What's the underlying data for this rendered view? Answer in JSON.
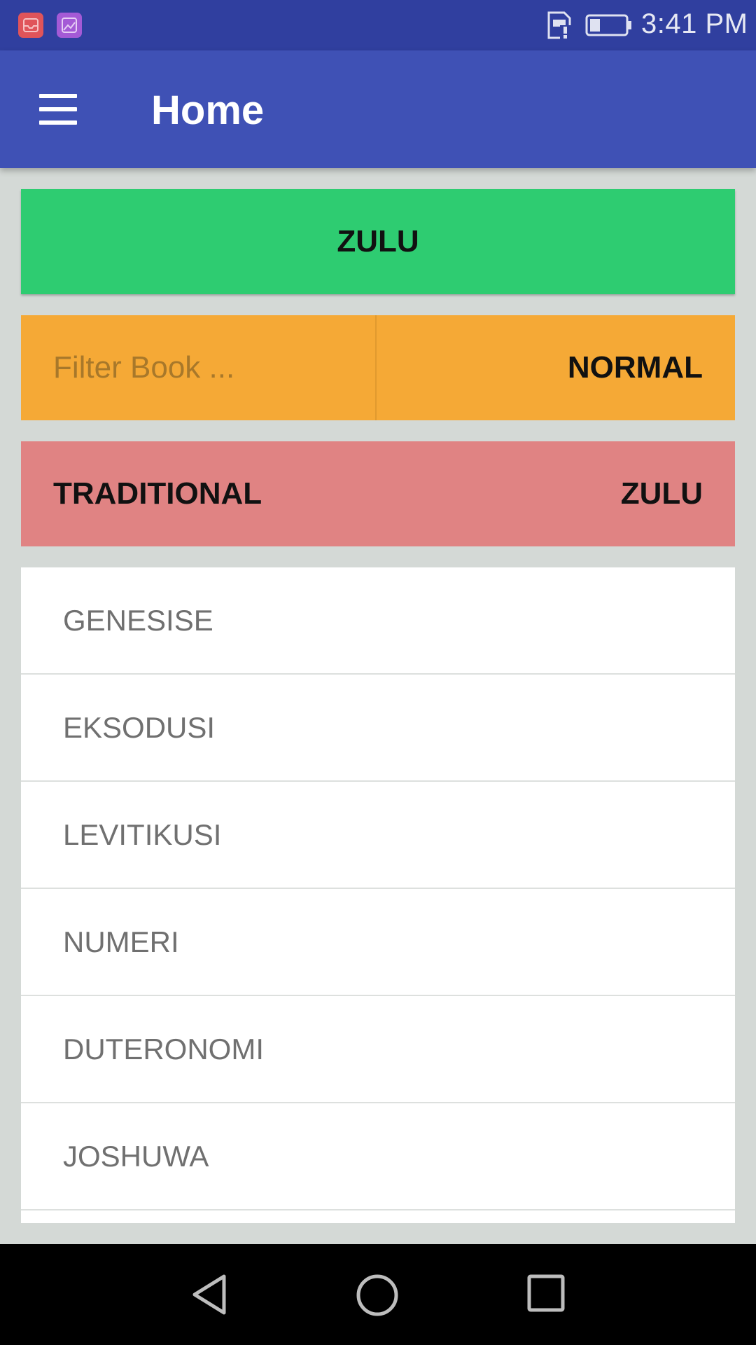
{
  "status_bar": {
    "time": "3:41 PM",
    "notification_icons": [
      "inbox-app-icon",
      "gallery-app-icon"
    ],
    "status_icons": [
      "sim-alert-icon",
      "battery-icon"
    ]
  },
  "app_bar": {
    "title": "Home",
    "menu_icon": "hamburger-menu-icon"
  },
  "language_button": {
    "label": "ZULU"
  },
  "filter": {
    "placeholder": "Filter Book ...",
    "value": "",
    "mode_label": "NORMAL"
  },
  "version_bar": {
    "left_label": "TRADITIONAL",
    "right_label": "ZULU"
  },
  "books": [
    {
      "name": "GENESISE"
    },
    {
      "name": "EKSODUSI"
    },
    {
      "name": "LEVITIKUSI"
    },
    {
      "name": "NUMERI"
    },
    {
      "name": "DUTERONOMI"
    },
    {
      "name": "JOSHUWA"
    }
  ],
  "colors": {
    "status_bar": "#303f9f",
    "app_bar": "#3f51b5",
    "language_button": "#2ecc71",
    "filter_row": "#f5a936",
    "version_bar": "#e08383",
    "background": "#d4d9d6"
  },
  "nav_bar": {
    "buttons": [
      "back-icon",
      "home-icon",
      "recents-icon"
    ]
  }
}
